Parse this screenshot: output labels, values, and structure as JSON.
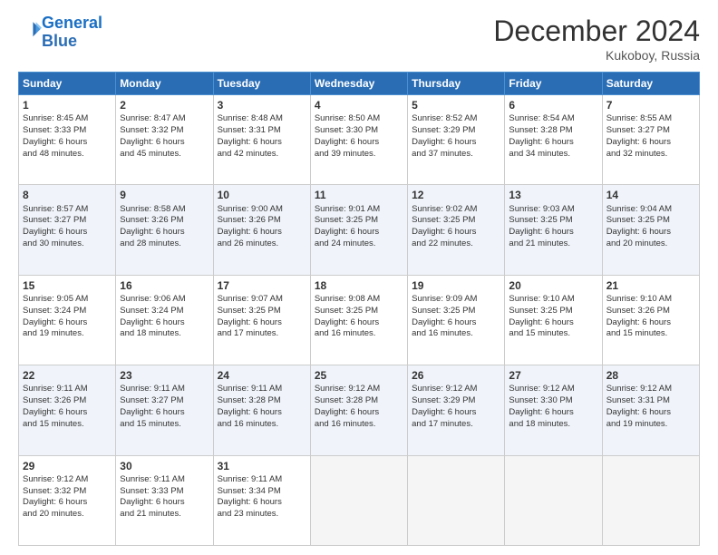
{
  "header": {
    "logo_line1": "General",
    "logo_line2": "Blue",
    "month_title": "December 2024",
    "location": "Kukoboy, Russia"
  },
  "weekdays": [
    "Sunday",
    "Monday",
    "Tuesday",
    "Wednesday",
    "Thursday",
    "Friday",
    "Saturday"
  ],
  "weeks": [
    [
      {
        "day": "1",
        "lines": [
          "Sunrise: 8:45 AM",
          "Sunset: 3:33 PM",
          "Daylight: 6 hours",
          "and 48 minutes."
        ]
      },
      {
        "day": "2",
        "lines": [
          "Sunrise: 8:47 AM",
          "Sunset: 3:32 PM",
          "Daylight: 6 hours",
          "and 45 minutes."
        ]
      },
      {
        "day": "3",
        "lines": [
          "Sunrise: 8:48 AM",
          "Sunset: 3:31 PM",
          "Daylight: 6 hours",
          "and 42 minutes."
        ]
      },
      {
        "day": "4",
        "lines": [
          "Sunrise: 8:50 AM",
          "Sunset: 3:30 PM",
          "Daylight: 6 hours",
          "and 39 minutes."
        ]
      },
      {
        "day": "5",
        "lines": [
          "Sunrise: 8:52 AM",
          "Sunset: 3:29 PM",
          "Daylight: 6 hours",
          "and 37 minutes."
        ]
      },
      {
        "day": "6",
        "lines": [
          "Sunrise: 8:54 AM",
          "Sunset: 3:28 PM",
          "Daylight: 6 hours",
          "and 34 minutes."
        ]
      },
      {
        "day": "7",
        "lines": [
          "Sunrise: 8:55 AM",
          "Sunset: 3:27 PM",
          "Daylight: 6 hours",
          "and 32 minutes."
        ]
      }
    ],
    [
      {
        "day": "8",
        "lines": [
          "Sunrise: 8:57 AM",
          "Sunset: 3:27 PM",
          "Daylight: 6 hours",
          "and 30 minutes."
        ]
      },
      {
        "day": "9",
        "lines": [
          "Sunrise: 8:58 AM",
          "Sunset: 3:26 PM",
          "Daylight: 6 hours",
          "and 28 minutes."
        ]
      },
      {
        "day": "10",
        "lines": [
          "Sunrise: 9:00 AM",
          "Sunset: 3:26 PM",
          "Daylight: 6 hours",
          "and 26 minutes."
        ]
      },
      {
        "day": "11",
        "lines": [
          "Sunrise: 9:01 AM",
          "Sunset: 3:25 PM",
          "Daylight: 6 hours",
          "and 24 minutes."
        ]
      },
      {
        "day": "12",
        "lines": [
          "Sunrise: 9:02 AM",
          "Sunset: 3:25 PM",
          "Daylight: 6 hours",
          "and 22 minutes."
        ]
      },
      {
        "day": "13",
        "lines": [
          "Sunrise: 9:03 AM",
          "Sunset: 3:25 PM",
          "Daylight: 6 hours",
          "and 21 minutes."
        ]
      },
      {
        "day": "14",
        "lines": [
          "Sunrise: 9:04 AM",
          "Sunset: 3:25 PM",
          "Daylight: 6 hours",
          "and 20 minutes."
        ]
      }
    ],
    [
      {
        "day": "15",
        "lines": [
          "Sunrise: 9:05 AM",
          "Sunset: 3:24 PM",
          "Daylight: 6 hours",
          "and 19 minutes."
        ]
      },
      {
        "day": "16",
        "lines": [
          "Sunrise: 9:06 AM",
          "Sunset: 3:24 PM",
          "Daylight: 6 hours",
          "and 18 minutes."
        ]
      },
      {
        "day": "17",
        "lines": [
          "Sunrise: 9:07 AM",
          "Sunset: 3:25 PM",
          "Daylight: 6 hours",
          "and 17 minutes."
        ]
      },
      {
        "day": "18",
        "lines": [
          "Sunrise: 9:08 AM",
          "Sunset: 3:25 PM",
          "Daylight: 6 hours",
          "and 16 minutes."
        ]
      },
      {
        "day": "19",
        "lines": [
          "Sunrise: 9:09 AM",
          "Sunset: 3:25 PM",
          "Daylight: 6 hours",
          "and 16 minutes."
        ]
      },
      {
        "day": "20",
        "lines": [
          "Sunrise: 9:10 AM",
          "Sunset: 3:25 PM",
          "Daylight: 6 hours",
          "and 15 minutes."
        ]
      },
      {
        "day": "21",
        "lines": [
          "Sunrise: 9:10 AM",
          "Sunset: 3:26 PM",
          "Daylight: 6 hours",
          "and 15 minutes."
        ]
      }
    ],
    [
      {
        "day": "22",
        "lines": [
          "Sunrise: 9:11 AM",
          "Sunset: 3:26 PM",
          "Daylight: 6 hours",
          "and 15 minutes."
        ]
      },
      {
        "day": "23",
        "lines": [
          "Sunrise: 9:11 AM",
          "Sunset: 3:27 PM",
          "Daylight: 6 hours",
          "and 15 minutes."
        ]
      },
      {
        "day": "24",
        "lines": [
          "Sunrise: 9:11 AM",
          "Sunset: 3:28 PM",
          "Daylight: 6 hours",
          "and 16 minutes."
        ]
      },
      {
        "day": "25",
        "lines": [
          "Sunrise: 9:12 AM",
          "Sunset: 3:28 PM",
          "Daylight: 6 hours",
          "and 16 minutes."
        ]
      },
      {
        "day": "26",
        "lines": [
          "Sunrise: 9:12 AM",
          "Sunset: 3:29 PM",
          "Daylight: 6 hours",
          "and 17 minutes."
        ]
      },
      {
        "day": "27",
        "lines": [
          "Sunrise: 9:12 AM",
          "Sunset: 3:30 PM",
          "Daylight: 6 hours",
          "and 18 minutes."
        ]
      },
      {
        "day": "28",
        "lines": [
          "Sunrise: 9:12 AM",
          "Sunset: 3:31 PM",
          "Daylight: 6 hours",
          "and 19 minutes."
        ]
      }
    ],
    [
      {
        "day": "29",
        "lines": [
          "Sunrise: 9:12 AM",
          "Sunset: 3:32 PM",
          "Daylight: 6 hours",
          "and 20 minutes."
        ]
      },
      {
        "day": "30",
        "lines": [
          "Sunrise: 9:11 AM",
          "Sunset: 3:33 PM",
          "Daylight: 6 hours",
          "and 21 minutes."
        ]
      },
      {
        "day": "31",
        "lines": [
          "Sunrise: 9:11 AM",
          "Sunset: 3:34 PM",
          "Daylight: 6 hours",
          "and 23 minutes."
        ]
      },
      null,
      null,
      null,
      null
    ]
  ]
}
